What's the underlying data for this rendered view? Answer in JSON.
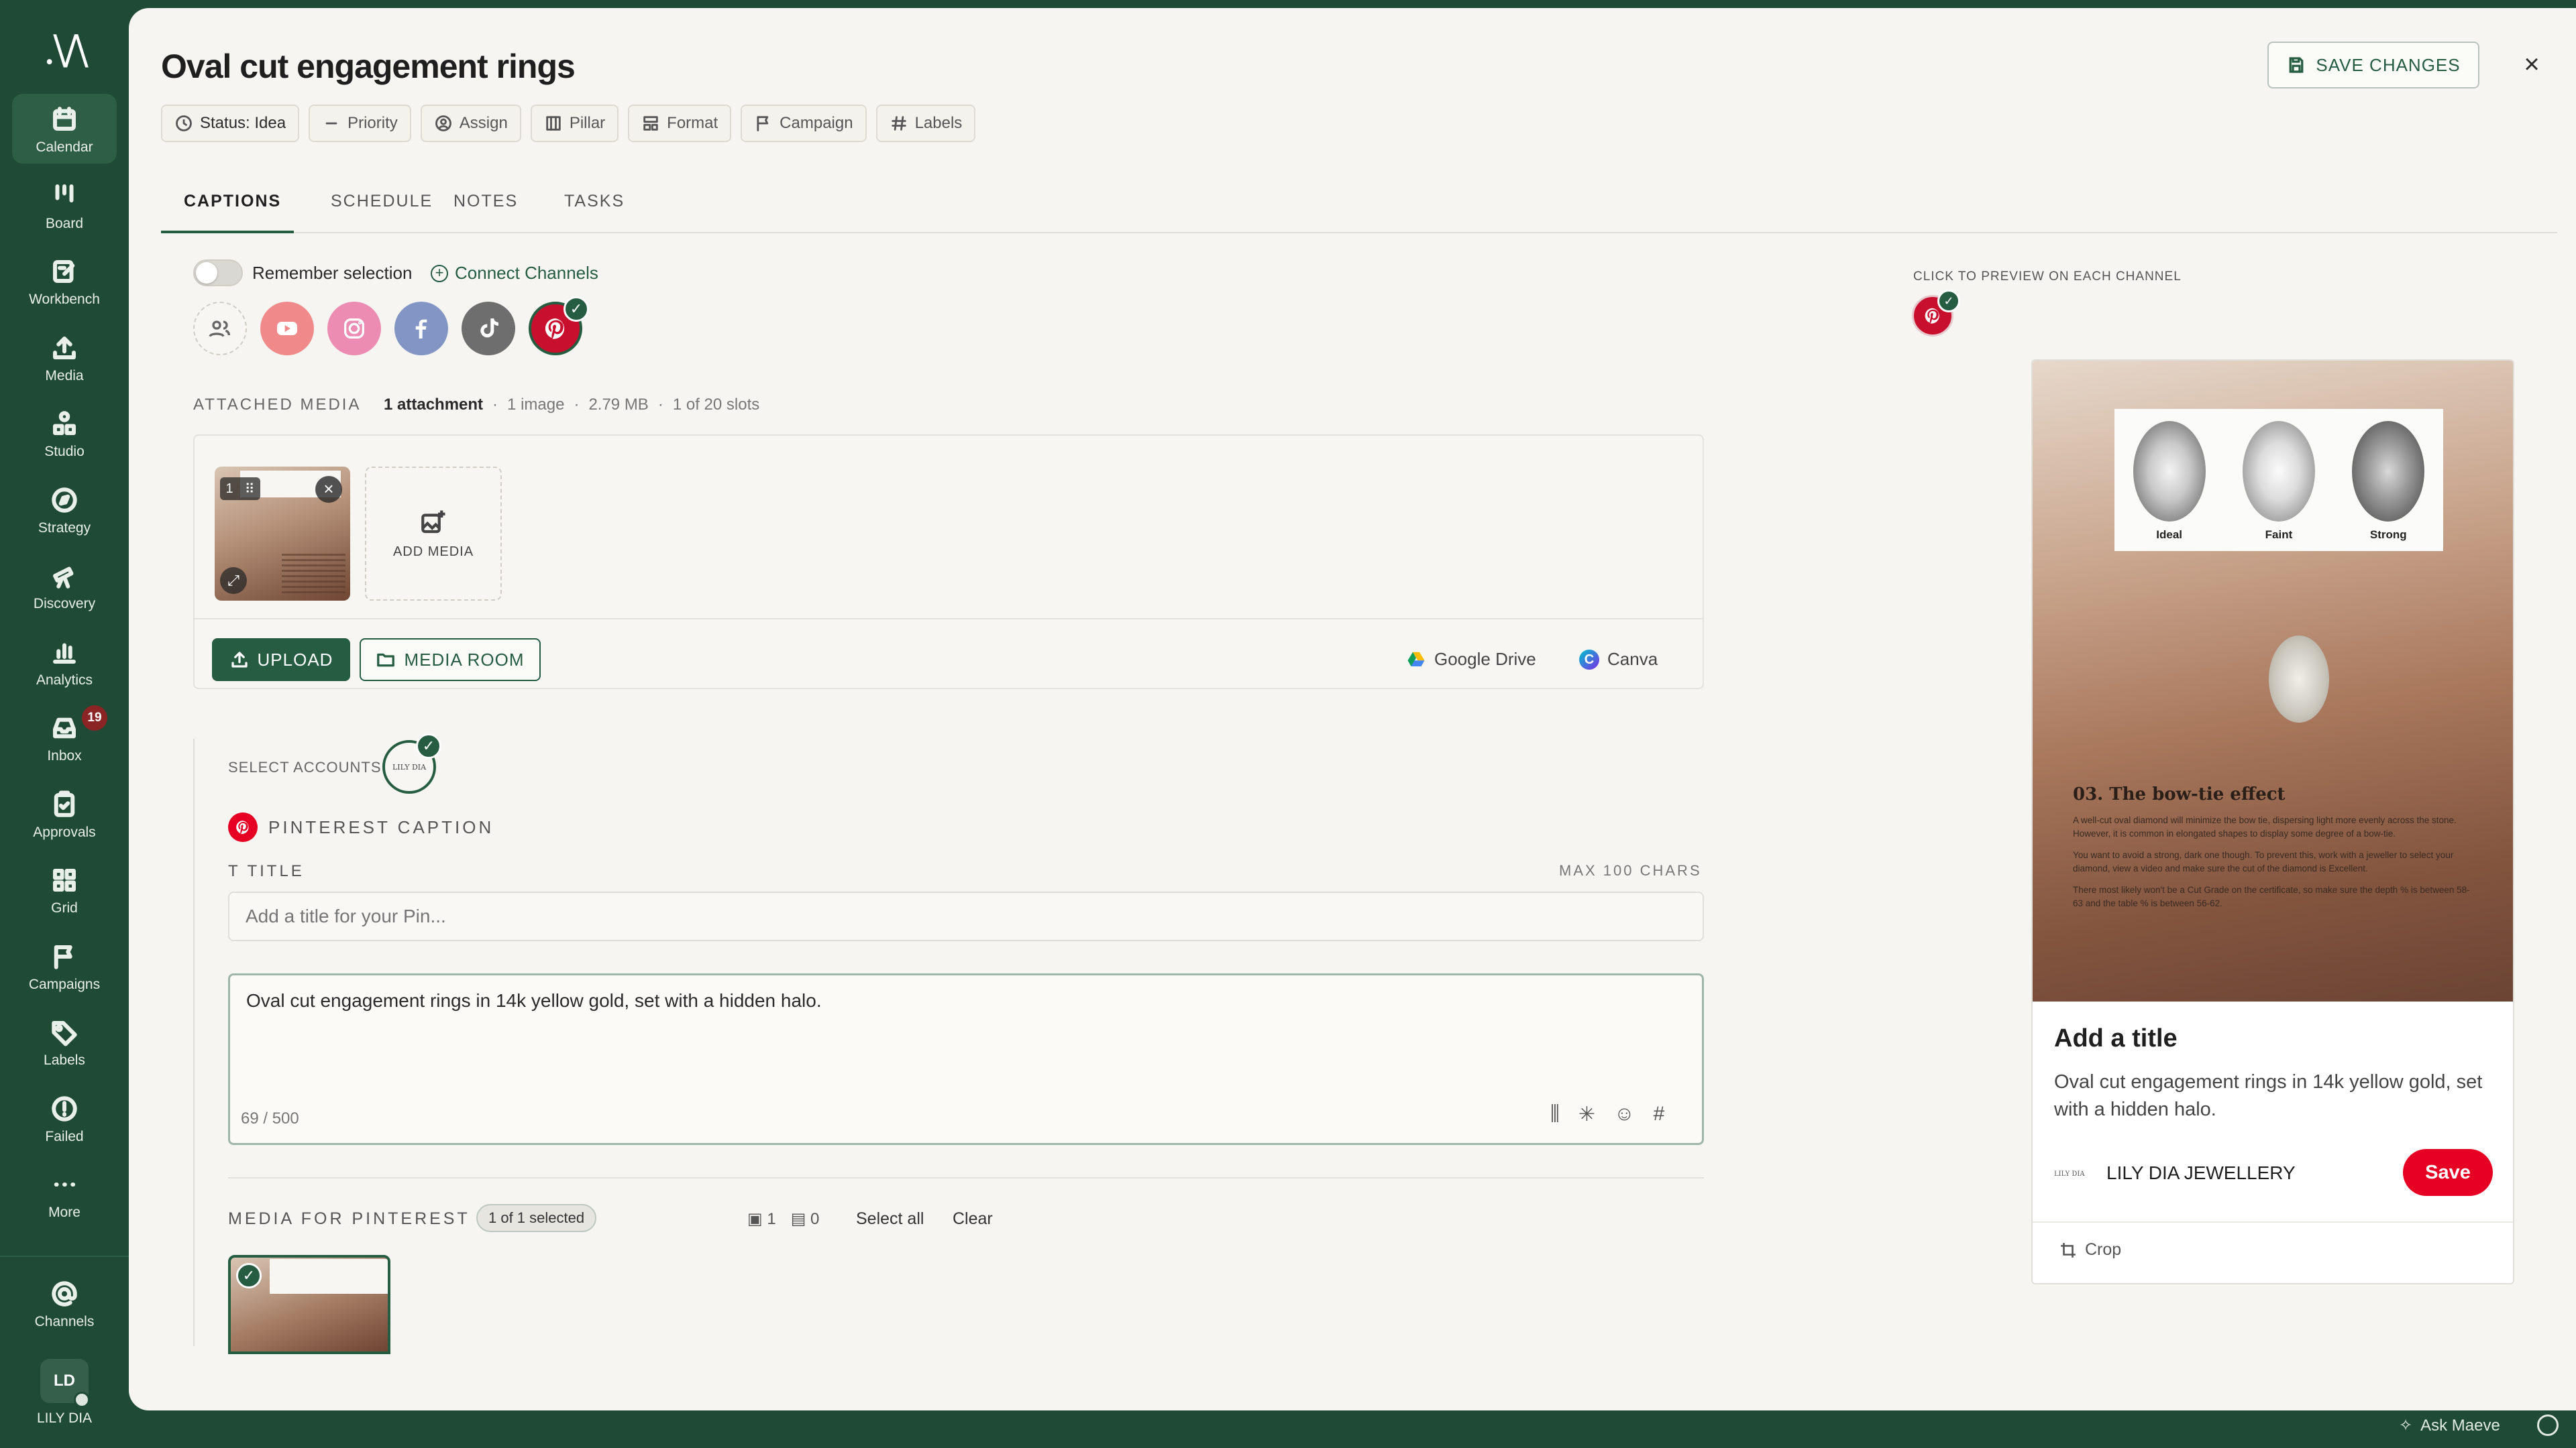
{
  "app": {
    "user_initials": "LD",
    "user_name": "LILY DIA"
  },
  "sidebar": {
    "items": [
      {
        "label": "Calendar",
        "icon": "calendar-icon",
        "active": true
      },
      {
        "label": "Board",
        "icon": "board-icon"
      },
      {
        "label": "Workbench",
        "icon": "workbench-icon"
      },
      {
        "label": "Media",
        "icon": "upload-icon"
      },
      {
        "label": "Studio",
        "icon": "studio-icon"
      },
      {
        "label": "Strategy",
        "icon": "compass-icon"
      },
      {
        "label": "Discovery",
        "icon": "telescope-icon"
      },
      {
        "label": "Analytics",
        "icon": "bar-chart-icon"
      },
      {
        "label": "Inbox",
        "icon": "inbox-icon",
        "badge": "19"
      },
      {
        "label": "Approvals",
        "icon": "clipboard-check-icon"
      },
      {
        "label": "Grid",
        "icon": "grid-icon"
      },
      {
        "label": "Campaigns",
        "icon": "flag-icon"
      },
      {
        "label": "Labels",
        "icon": "tag-icon"
      },
      {
        "label": "Failed",
        "icon": "alert-circle-icon"
      },
      {
        "label": "More",
        "icon": "more-icon"
      }
    ],
    "channels_label": "Channels"
  },
  "post": {
    "title": "Oval cut engagement rings",
    "save_label": "SAVE CHANGES",
    "chips": [
      "Status: Idea",
      "Priority",
      "Assign",
      "Pillar",
      "Format",
      "Campaign",
      "Labels"
    ],
    "tabs": [
      "CAPTIONS",
      "SCHEDULE",
      "NOTES",
      "TASKS"
    ]
  },
  "channels": {
    "remember_label": "Remember selection",
    "connect_label": "Connect Channels"
  },
  "attached": {
    "label": "ATTACHED MEDIA",
    "count": "1 attachment",
    "images": "1 image",
    "size": "2.79 MB",
    "slots": "1 of 20 slots",
    "thumb_index": "1",
    "add_label": "ADD MEDIA",
    "upload_label": "UPLOAD",
    "media_room_label": "MEDIA ROOM",
    "gdrive_label": "Google Drive",
    "canva_label": "Canva"
  },
  "accounts": {
    "label": "SELECT ACCOUNTS",
    "logo_text": "LILY DIA"
  },
  "caption": {
    "section_label": "PINTEREST CAPTION",
    "title_label": "TITLE",
    "max_chars": "MAX 100 CHARS",
    "title_placeholder": "Add a title for your Pin...",
    "text": "Oval cut engagement rings in 14k yellow gold, set with a hidden halo.",
    "count": "69 / 500"
  },
  "media_for": {
    "label": "MEDIA FOR PINTEREST",
    "selected": "1 of 1 selected",
    "images": "1",
    "videos": "0",
    "select_all": "Select all",
    "clear": "Clear"
  },
  "preview": {
    "hint": "CLICK TO PREVIEW ON EACH CHANNEL",
    "image_labels": [
      "Ideal",
      "Faint",
      "Strong"
    ],
    "image_heading": "03. The bow-tie effect",
    "image_paragraphs": [
      "A well-cut oval diamond will minimize the bow tie, dispersing light more evenly across the stone. However, it is common in elongated shapes to display some degree of a bow-tie.",
      "You want to avoid a strong, dark one though. To prevent this, work with a jeweller to select your diamond, view a video and make sure the cut of the diamond is Excellent.",
      "There most likely won't be a Cut Grade on the certificate, so make sure the depth % is between 58-63 and the table % is between 56-62."
    ],
    "title": "Add a title",
    "description": "Oval cut engagement rings in 14k yellow gold, set with a hidden halo.",
    "brand_logo": "LILY DIA",
    "brand": "LILY DIA JEWELLERY",
    "save_label": "Save",
    "crop_label": "Crop"
  },
  "footer": {
    "ask_label": "Ask Maeve"
  },
  "colors": {
    "brand_green": "#1f4a35",
    "accent_green": "#255c42",
    "pinterest_red": "#e60023",
    "inbox_badge": "#8b2424"
  }
}
